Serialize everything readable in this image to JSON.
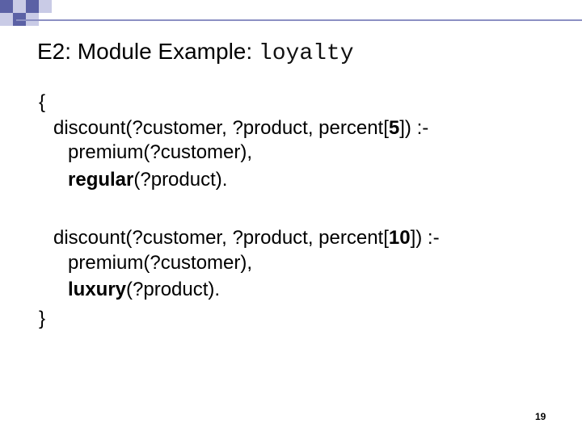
{
  "slide": {
    "title_prefix": "E2: Module Example: ",
    "title_code": "loyalty",
    "open_brace": "{",
    "close_brace": "}",
    "rules": [
      {
        "head_pre": "discount(?customer, ?product, percent[",
        "head_value": "5",
        "head_post": "]) :-",
        "body1": "premium(?customer),",
        "body2_bold": "regular",
        "body2_rest": "(?product)."
      },
      {
        "head_pre": "discount(?customer, ?product, percent[",
        "head_value": "10",
        "head_post": "]) :-",
        "body1": "premium(?customer),",
        "body2_bold": "luxury",
        "body2_rest": "(?product)."
      }
    ],
    "page_number": "19"
  },
  "colors": {
    "deco_dark": "#5b61a5",
    "deco_light": "#c9cbe6",
    "rule_line": "#8c90c3"
  }
}
